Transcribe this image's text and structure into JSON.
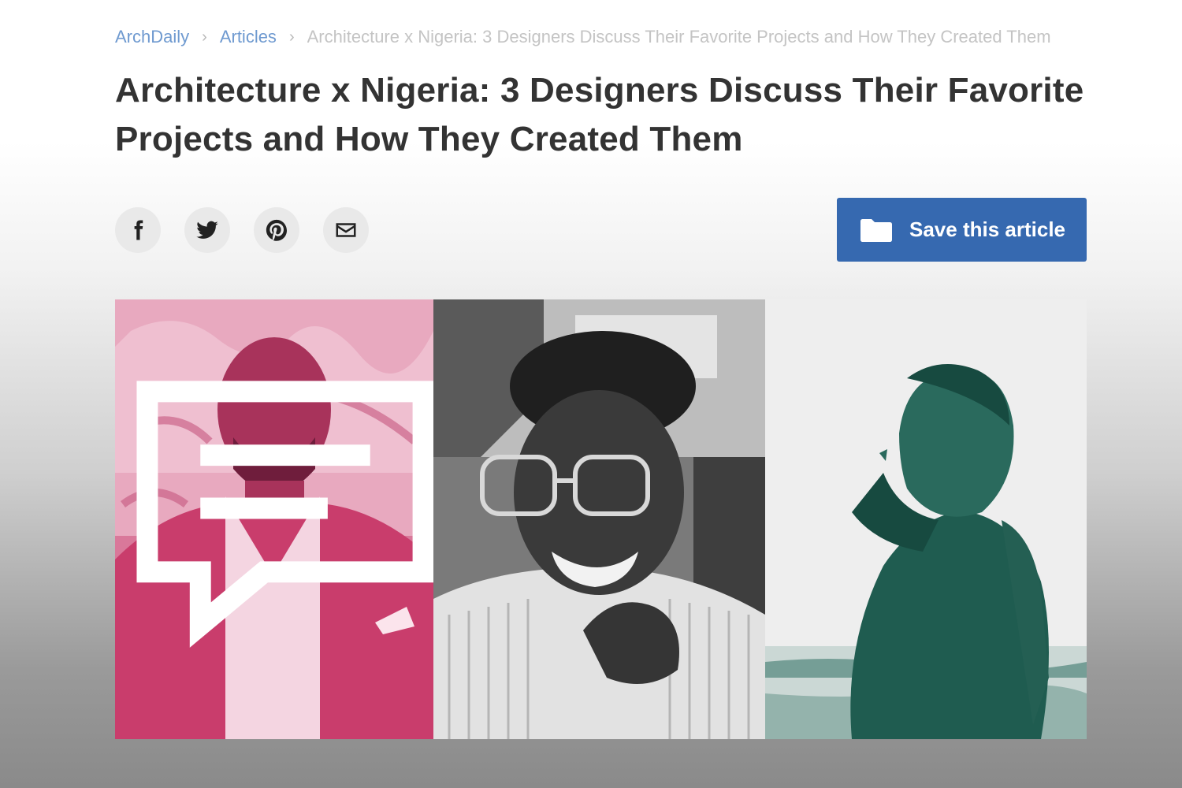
{
  "breadcrumb": {
    "items": [
      "ArchDaily",
      "Articles"
    ],
    "current": "Architecture x Nigeria: 3 Designers Discuss Their Favorite Projects and How They Created Them",
    "separator": "›"
  },
  "article": {
    "title": "Architecture x Nigeria: 3 Designers Discuss Their Favorite Projects and How They Created Them"
  },
  "share": {
    "icons": [
      "facebook-icon",
      "twitter-icon",
      "pinterest-icon",
      "email-icon"
    ]
  },
  "save_button": {
    "label": "Save this article",
    "icon": "folder-icon",
    "color": "#3669b0"
  },
  "hero": {
    "panels": [
      {
        "tint": "#c93d6c",
        "description_icon": "portrait-man-suit"
      },
      {
        "tint": "#8f8f8f",
        "description_icon": "portrait-woman-glasses"
      },
      {
        "tint": "#2f6f62",
        "description_icon": "portrait-man-profile"
      }
    ],
    "comment_icon": "comment-icon"
  }
}
